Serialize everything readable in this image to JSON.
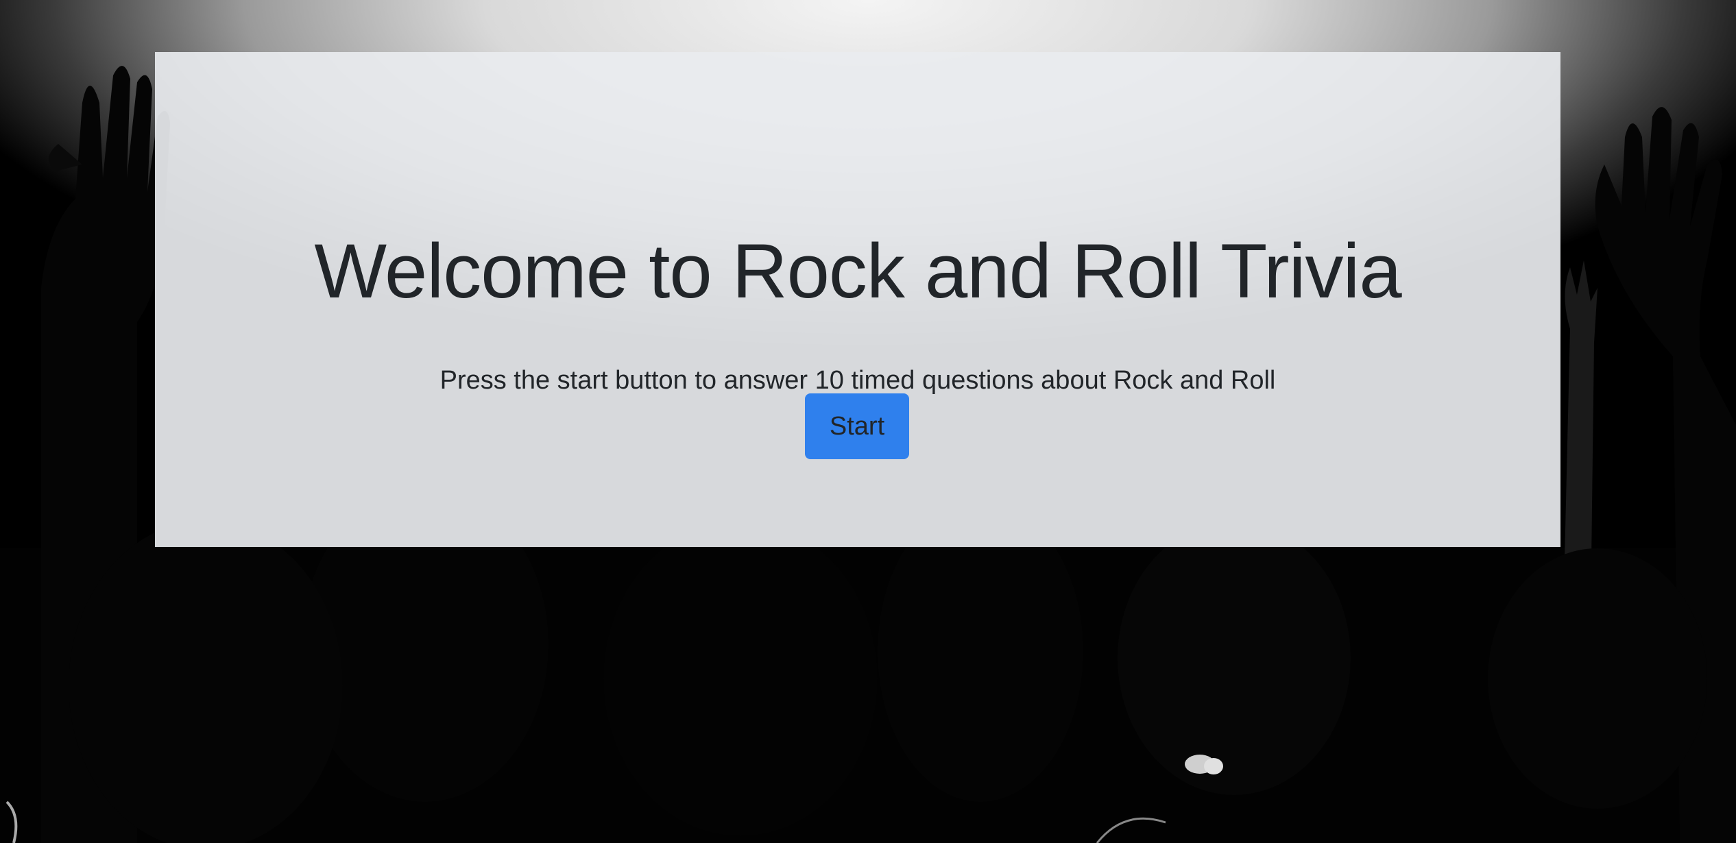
{
  "hero": {
    "title": "Welcome to Rock and Roll Trivia",
    "lead": "Press the start button to answer 10 timed questions about Rock and Roll",
    "start_label": "Start"
  },
  "colors": {
    "panel_background": "#e9ecef",
    "button_background": "#2f80ed",
    "text": "#212529"
  }
}
